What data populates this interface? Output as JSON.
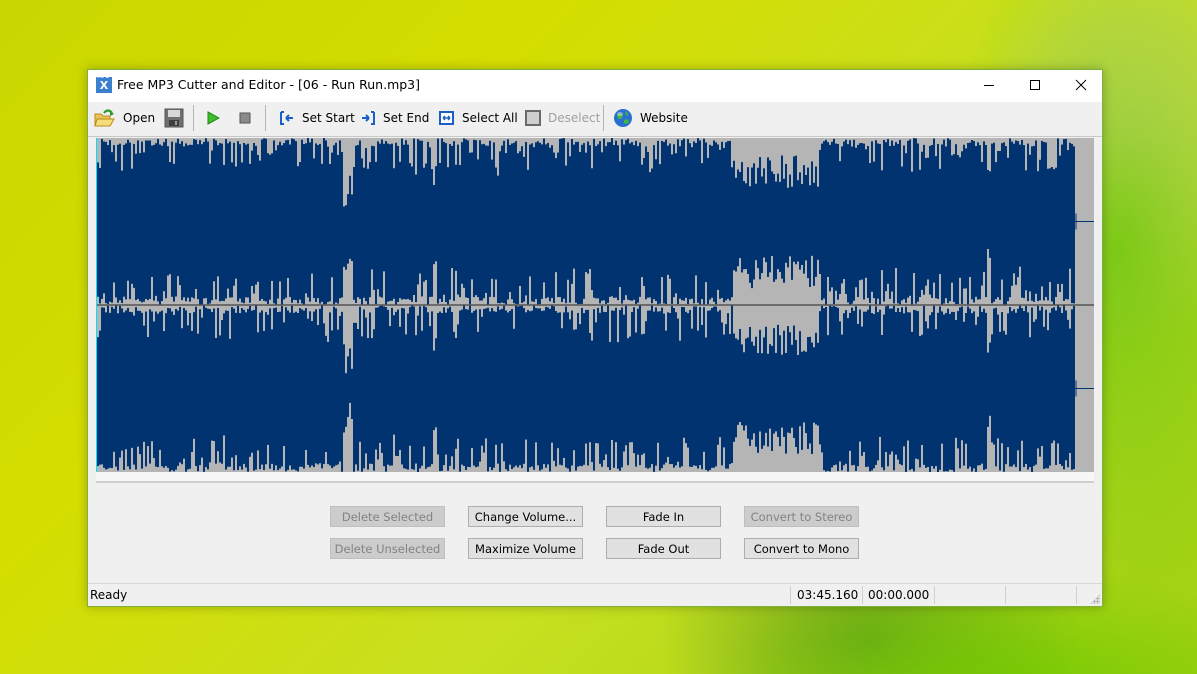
{
  "window": {
    "title": "Free MP3 Cutter and Editor - [06 - Run Run.mp3]",
    "controls": {
      "minimize": "—",
      "maximize": "☐",
      "close": "✕"
    }
  },
  "toolbar": {
    "open_label": "Open",
    "set_start_label": "Set Start",
    "set_end_label": "Set End",
    "select_all_label": "Select All",
    "deselect_label": "Deselect",
    "website_label": "Website",
    "icons": [
      "open-folder-icon",
      "save-disk-icon",
      "play-icon",
      "stop-icon",
      "set-start-icon",
      "set-end-icon",
      "select-all-icon",
      "deselect-icon",
      "globe-icon"
    ]
  },
  "waveform": {
    "channels": 2,
    "selection": "entire track selected",
    "colors": {
      "selected_wave": "#003370",
      "background": "#b5b5b5",
      "center_line": "#555555",
      "cursor": "#00e0ff"
    }
  },
  "actions": {
    "delete_selected": {
      "label": "Delete Selected",
      "enabled": false
    },
    "delete_unselected": {
      "label": "Delete Unselected",
      "enabled": false
    },
    "change_volume": {
      "label": "Change Volume...",
      "enabled": true
    },
    "maximize_volume": {
      "label": "Maximize Volume",
      "enabled": true
    },
    "fade_in": {
      "label": "Fade In",
      "enabled": true
    },
    "fade_out": {
      "label": "Fade Out",
      "enabled": true
    },
    "convert_stereo": {
      "label": "Convert to Stereo",
      "enabled": false
    },
    "convert_mono": {
      "label": "Convert to Mono",
      "enabled": true
    }
  },
  "status": {
    "text": "Ready",
    "duration": "03:45.160",
    "position": "00:00.000"
  }
}
